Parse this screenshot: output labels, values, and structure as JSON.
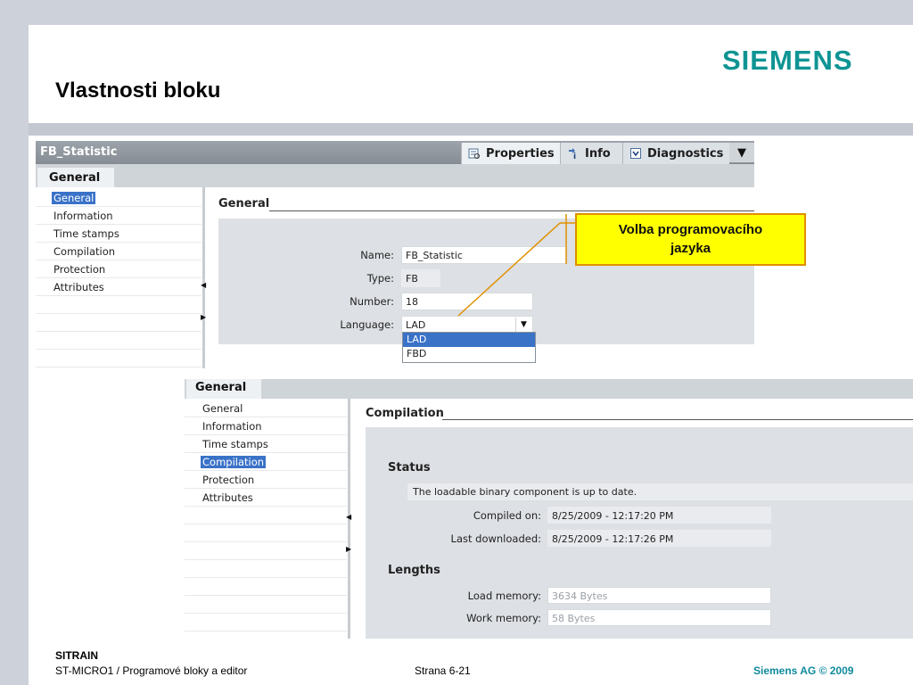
{
  "slide": {
    "title": "Vlastnosti bloku",
    "logo": "SIEMENS",
    "colors": {
      "logo": "#0f9494",
      "callout_bg": "#ffff00",
      "callout_border": "#e09000",
      "selection": "#3a72c8"
    },
    "footer": {
      "brand": "SITRAIN",
      "course": "ST-MICRO1 / Programové bloky a editor",
      "page": "Strana 6-21",
      "copyright": "Siemens AG © 2009"
    }
  },
  "callout": {
    "line1": "Volba programovacího",
    "line2": "jazyka"
  },
  "panel1": {
    "window_title": "FB_Statistic",
    "tabs": [
      {
        "label": "Properties",
        "icon": "properties-icon"
      },
      {
        "label": "Info",
        "icon": "info-icon"
      },
      {
        "label": "Diagnostics",
        "icon": "diagnostics-icon"
      }
    ],
    "general_tab": "General",
    "nav": [
      "General",
      "Information",
      "Time stamps",
      "Compilation",
      "Protection",
      "Attributes"
    ],
    "selected_nav": "General",
    "section_title": "General",
    "fields": {
      "name_label": "Name:",
      "name_value": "FB_Statistic",
      "type_label": "Type:",
      "type_value": "FB",
      "number_label": "Number:",
      "number_value": "18",
      "language_label": "Language:",
      "language_value": "LAD"
    },
    "language_options": [
      "LAD",
      "FBD"
    ]
  },
  "panel2": {
    "general_tab": "General",
    "nav": [
      "General",
      "Information",
      "Time stamps",
      "Compilation",
      "Protection",
      "Attributes"
    ],
    "selected_nav": "Compilation",
    "section_title": "Compilation",
    "status_heading": "Status",
    "status_text": "The loadable binary component is up to date.",
    "compiled_label": "Compiled on:",
    "compiled_value": "8/25/2009 - 12:17:20 PM",
    "downloaded_label": "Last downloaded:",
    "downloaded_value": "8/25/2009 - 12:17:26 PM",
    "lengths_heading": "Lengths",
    "load_label": "Load memory:",
    "load_value": "3634 Bytes",
    "work_label": "Work memory:",
    "work_value": "58 Bytes"
  }
}
